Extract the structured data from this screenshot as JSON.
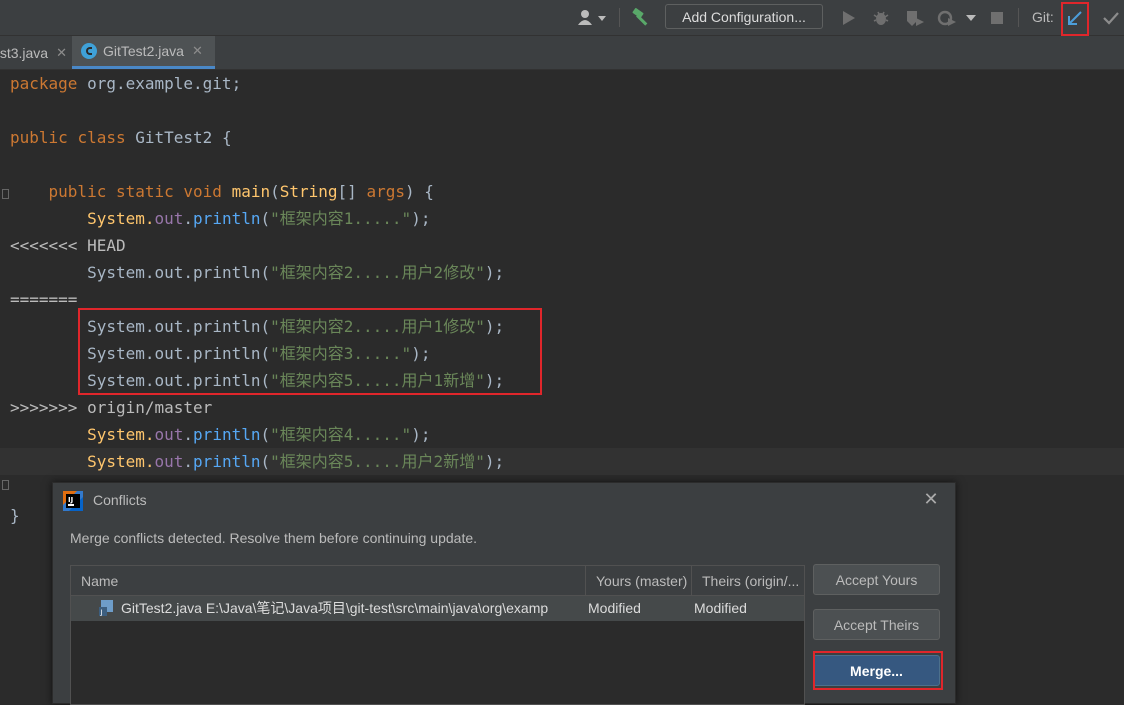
{
  "toolbar": {
    "add_config_label": "Add Configuration...",
    "git_label": "Git:",
    "icons": [
      "user-icon",
      "build-hammer-icon",
      "run-icon",
      "debug-icon",
      "coverage-icon",
      "profile-icon",
      "stop-icon",
      "git-update-icon",
      "git-commit-icon"
    ]
  },
  "tabs": [
    {
      "label": "st3.java",
      "close": "✕"
    },
    {
      "label": "GitTest2.java",
      "close": "✕"
    }
  ],
  "code": {
    "l1": {
      "kw": "package",
      "rest": " org.example.git;"
    },
    "l3": {
      "kw1": "public",
      "kw2": "class",
      "rest": " GitTest2 {"
    },
    "l5": {
      "kw1": "public",
      "kw2": "static",
      "kw3": "void",
      "name": "main",
      "p1": "(",
      "type": "String",
      "p2": "[] ",
      "param": "args",
      "p3": ") {"
    },
    "print_head": "System.",
    "out": "out",
    "println": "println",
    "lines": {
      "s1": "\"框架内容1.....\"",
      "s2": "\"框架内容2.....用户2修改\"",
      "s3": "\"框架内容2.....用户1修改\"",
      "s4": "\"框架内容3.....\"",
      "s5": "\"框架内容5.....用户1新增\"",
      "s6": "\"框架内容4.....\"",
      "s7": "\"框架内容5.....用户2新增\""
    },
    "marker_head": "<<<<<<< HEAD",
    "marker_sep": "=======",
    "marker_tail": ">>>>>>> origin/master",
    "close_brace": "}",
    "end": ");"
  },
  "dialog": {
    "title": "Conflicts",
    "message": "Merge conflicts detected. Resolve them before continuing update.",
    "columns": [
      "Name",
      "Yours (master)",
      "Theirs (origin/..."
    ],
    "rows": [
      {
        "file": "GitTest2.java",
        "path": "E:\\Java\\笔记\\Java项目\\git-test\\src\\main\\java\\org\\examp",
        "yours": "Modified",
        "theirs": "Modified"
      }
    ],
    "buttons": {
      "accept_yours": "Accept Yours",
      "accept_theirs": "Accept Theirs",
      "merge": "Merge..."
    }
  }
}
